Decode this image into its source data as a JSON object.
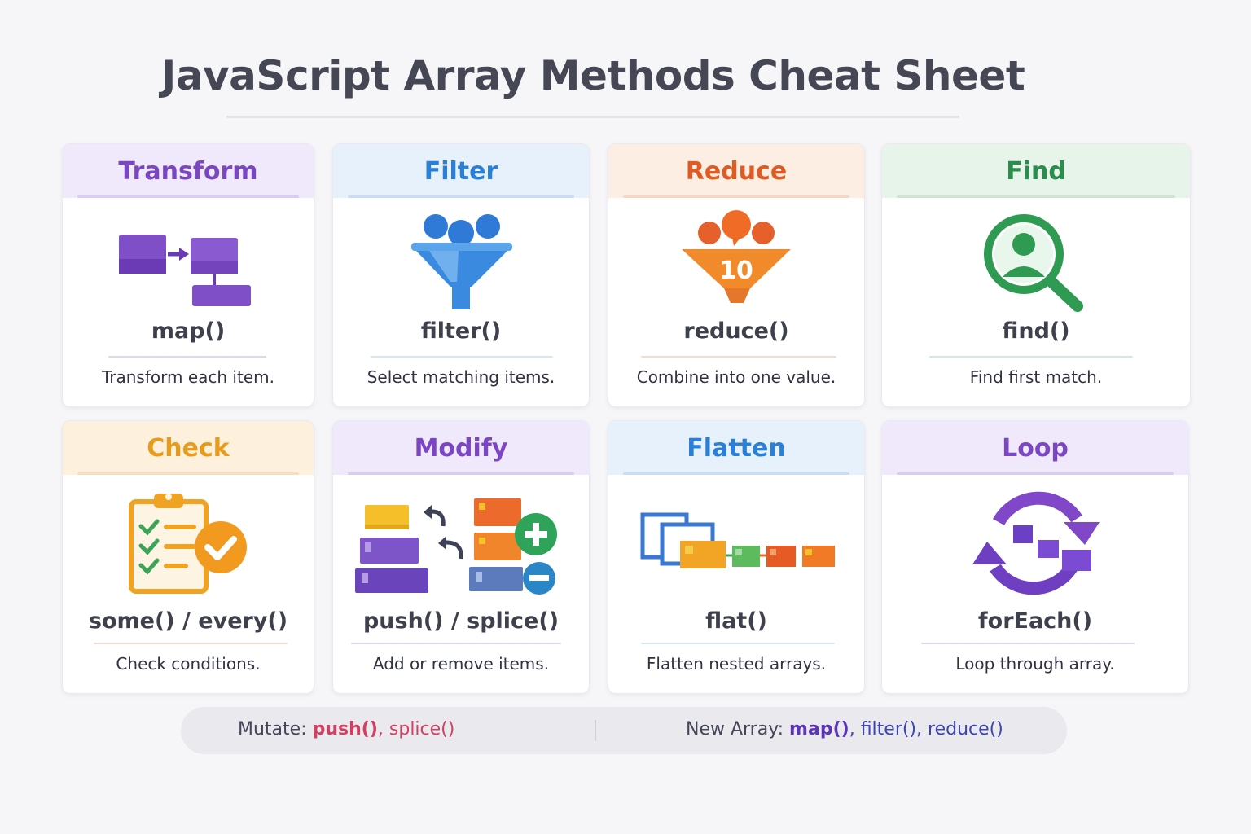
{
  "title": "JavaScript Array Methods Cheat Sheet",
  "cards": [
    {
      "category": "Transform",
      "method": "map()",
      "description": "Transform each item.",
      "icon": "map-transform-icon",
      "color": "#7b46c2",
      "header_bg": "#efe9fb",
      "rule": "#d9ccf3"
    },
    {
      "category": "Filter",
      "method": "filter()",
      "description": "Select matching items.",
      "icon": "funnel-filter-icon",
      "color": "#2a7fd6",
      "header_bg": "#e6f1fc",
      "rule": "#c8ddf5"
    },
    {
      "category": "Reduce",
      "method": "reduce()",
      "description": "Combine into one value.",
      "icon": "reduce-funnel-icon",
      "color": "#e05a23",
      "header_bg": "#fdeee4",
      "rule": "#f6d7c6"
    },
    {
      "category": "Find",
      "method": "find()",
      "description": "Find first match.",
      "icon": "magnifier-user-icon",
      "color": "#2b8c4e",
      "header_bg": "#e6f4ea",
      "rule": "#cbe6d3"
    },
    {
      "category": "Check",
      "method": "some() / every()",
      "description": "Check conditions.",
      "icon": "clipboard-check-icon",
      "color": "#e69b1c",
      "header_bg": "#fdf0dc",
      "rule": "#f5dfbd"
    },
    {
      "category": "Modify",
      "method": "push() / splice()",
      "description": "Add or remove items.",
      "icon": "add-remove-blocks-icon",
      "color": "#7b46c2",
      "header_bg": "#efe9fb",
      "rule": "#d9ccf3"
    },
    {
      "category": "Flatten",
      "method": "flat()",
      "description": "Flatten nested arrays.",
      "icon": "flatten-arrays-icon",
      "color": "#2a7fd6",
      "header_bg": "#e6f1fc",
      "rule": "#c8ddf5"
    },
    {
      "category": "Loop",
      "method": "forEach()",
      "description": "Loop through array.",
      "icon": "loop-cycle-icon",
      "color": "#7b46c2",
      "header_bg": "#efe9fb",
      "rule": "#d9ccf3"
    }
  ],
  "footer": {
    "mutate_label": "Mutate:",
    "mutate_primary": "push()",
    "mutate_sep": ",",
    "mutate_secondary": "splice()",
    "new_label": "New Array:",
    "new_primary": "map()",
    "new_sep": ",",
    "new_secondary": "filter(), reduce()"
  }
}
